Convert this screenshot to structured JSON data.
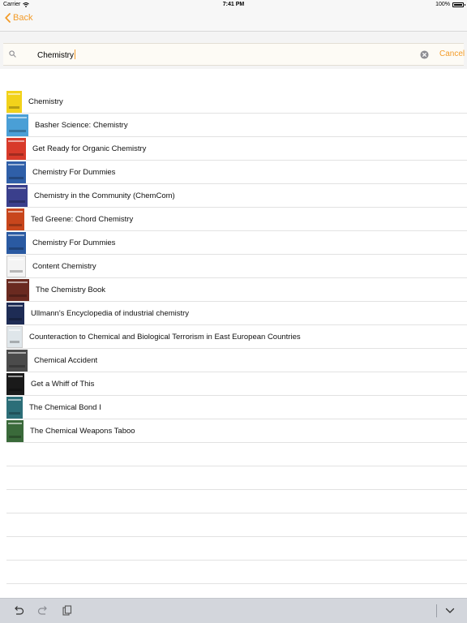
{
  "status_bar": {
    "carrier": "Carrier",
    "time": "7:41 PM",
    "battery": "100%"
  },
  "nav": {
    "back_label": "Back"
  },
  "search": {
    "query": "Chemistry",
    "cancel_label": "Cancel"
  },
  "results": [
    {
      "title": "Chemistry",
      "cover_color": "#f2d21a"
    },
    {
      "title": "Basher Science: Chemistry",
      "cover_color": "#4a9fd6"
    },
    {
      "title": "Get Ready for Organic Chemistry",
      "cover_color": "#d83a2a"
    },
    {
      "title": "Chemistry For Dummies",
      "cover_color": "#2f5fa8"
    },
    {
      "title": "Chemistry in the Community (ChemCom)",
      "cover_color": "#3a3f8c"
    },
    {
      "title": "Ted Greene: Chord Chemistry",
      "cover_color": "#c8461c"
    },
    {
      "title": "Chemistry For Dummies",
      "cover_color": "#2a5aa2"
    },
    {
      "title": "Content Chemistry",
      "cover_color": "#f4f4f4"
    },
    {
      "title": "The Chemistry Book",
      "cover_color": "#6a2a20"
    },
    {
      "title": "Ullmann's Encyclopedia of industrial chemistry",
      "cover_color": "#1e2c55"
    },
    {
      "title": "Counteraction to Chemical and Biological Terrorism in East European Countries",
      "cover_color": "#dfe6ea"
    },
    {
      "title": "Chemical Accident",
      "cover_color": "#4b4b4b"
    },
    {
      "title": "Get a Whiff of This",
      "cover_color": "#1a1a1a"
    },
    {
      "title": "The Chemical Bond I",
      "cover_color": "#2c6e78"
    },
    {
      "title": "The Chemical Weapons Taboo",
      "cover_color": "#3a6a3a"
    }
  ]
}
